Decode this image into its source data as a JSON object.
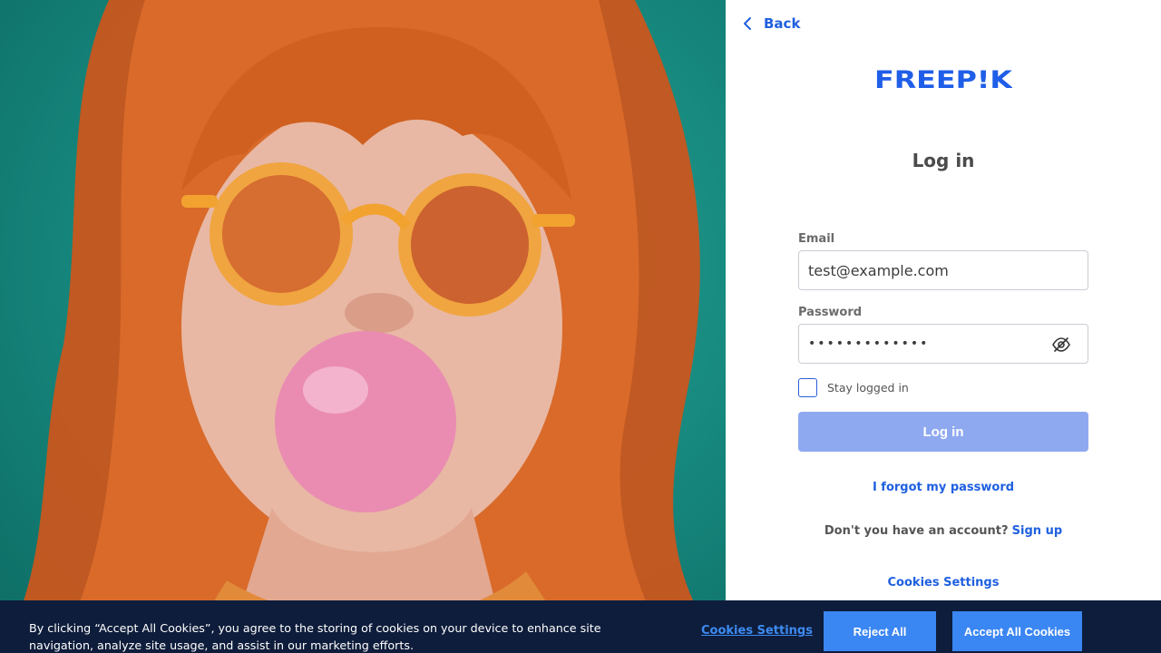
{
  "nav": {
    "back_label": "Back"
  },
  "brand": {
    "logo_text": "FREEP!K",
    "color": "#1f5ee8"
  },
  "login": {
    "title": "Log in",
    "email_label": "Email",
    "email_value": "test@example.com",
    "password_label": "Password",
    "password_value": "•••••••••••••",
    "stay_logged_in_label": "Stay logged in",
    "stay_logged_in_checked": false,
    "submit_label": "Log in",
    "forgot_password_label": "I forgot my password",
    "no_account_text": "Don't you have an account?",
    "signup_label": "Sign up",
    "cookies_settings_label": "Cookies Settings"
  },
  "icons": {
    "back": "chevron-left-icon",
    "password_toggle": "eye-slash-icon"
  },
  "cookie_banner": {
    "text": "By clicking “Accept All Cookies”, you agree to the storing of cookies on your device to enhance site navigation, analyze site usage, and assist in our marketing efforts.",
    "settings_label": "Cookies Settings",
    "reject_label": "Reject All",
    "accept_label": "Accept All Cookies",
    "background": "#0e1d3b",
    "button_color": "#3a86f2"
  },
  "colors": {
    "accent": "#1f60e0",
    "button_disabled": "#8fa9f0"
  }
}
